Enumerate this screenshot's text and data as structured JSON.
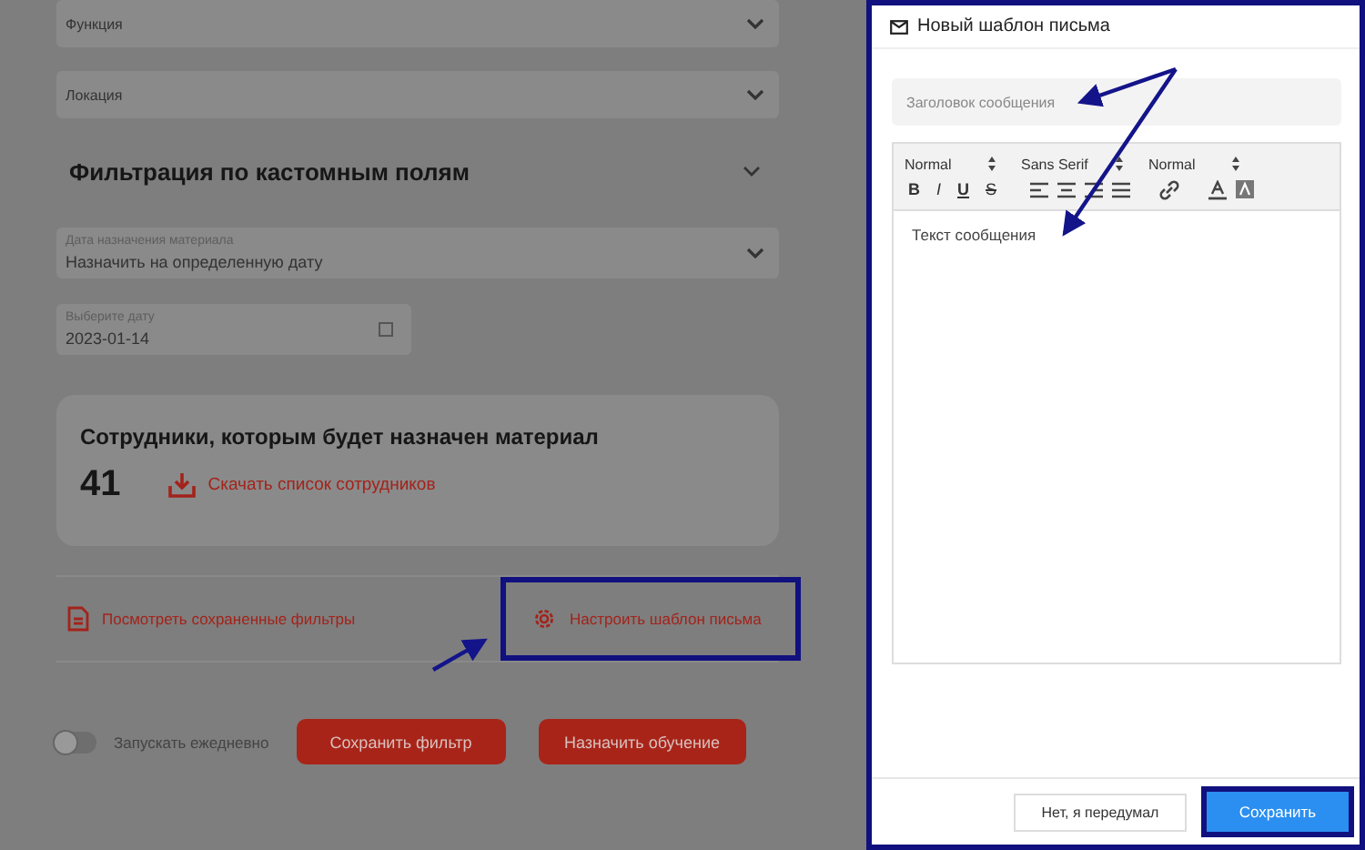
{
  "filters": [
    {
      "label": "Функция"
    },
    {
      "label": "Локация"
    }
  ],
  "custom_filter": {
    "title": "Фильтрация по кастомным полям"
  },
  "assign_date": {
    "label": "Дата назначения материала",
    "value": "Назначить на определенную дату"
  },
  "pick_date": {
    "label": "Выберите дату",
    "value": "2023-01-14"
  },
  "employees": {
    "title": "Сотрудники, которым будет назначен материал",
    "count": "41",
    "download": "Скачать список сотрудников"
  },
  "links": [
    {
      "kind": "file",
      "label": "Посмотреть сохраненные фильтры",
      "highlighted": false
    },
    {
      "kind": "gear",
      "label": "Настроить шаблон письма",
      "highlighted": true
    }
  ],
  "daily": {
    "label": "Запускать ежедневно",
    "on": false
  },
  "actions": [
    "Сохранить фильтр",
    "Назначить обучение"
  ],
  "modal": {
    "title": "Новый шаблон письма",
    "subject_placeholder": "Заголовок сообщения",
    "selects": [
      "Normal",
      "Sans Serif",
      "Normal"
    ],
    "formats": [
      "B",
      "I",
      "U",
      "S"
    ],
    "body_placeholder": "Текст сообщения",
    "cancel": "Нет, я передумал",
    "save": "Сохранить",
    "save_highlighted": true
  }
}
